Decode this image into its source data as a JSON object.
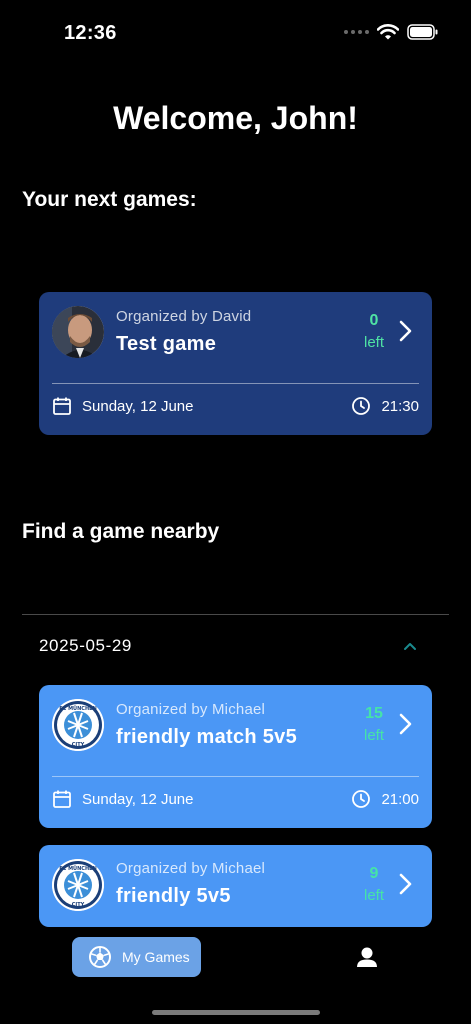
{
  "status_bar": {
    "time": "12:36"
  },
  "header": {
    "welcome": "Welcome, John!"
  },
  "next_games": {
    "title": "Your next games:",
    "cards": [
      {
        "organizer": "Organized by David",
        "name": "Test game",
        "spots_left": "0",
        "left_label": "left",
        "date": "Sunday, 12 June",
        "time": "21:30"
      }
    ]
  },
  "nearby": {
    "title": "Find a game nearby",
    "date_group": "2025-05-29",
    "cards": [
      {
        "organizer": "Organized by Michael",
        "name": "friendly match 5v5",
        "spots_left": "15",
        "left_label": "left",
        "date": "Sunday, 12 June",
        "time": "21:00"
      },
      {
        "organizer": "Organized by Michael",
        "name": "friendly 5v5",
        "spots_left": "9",
        "left_label": "left"
      }
    ]
  },
  "bottom_nav": {
    "my_games_label": "My Games",
    "active_icon": "soccer-ball-icon",
    "profile_icon": "person-icon"
  },
  "colors": {
    "background": "#000000",
    "card_dark": "#1f3c7c",
    "card_light": "#4b97f5",
    "spots_green": "#4fe3a4",
    "nav_active": "#6ba2e6"
  }
}
